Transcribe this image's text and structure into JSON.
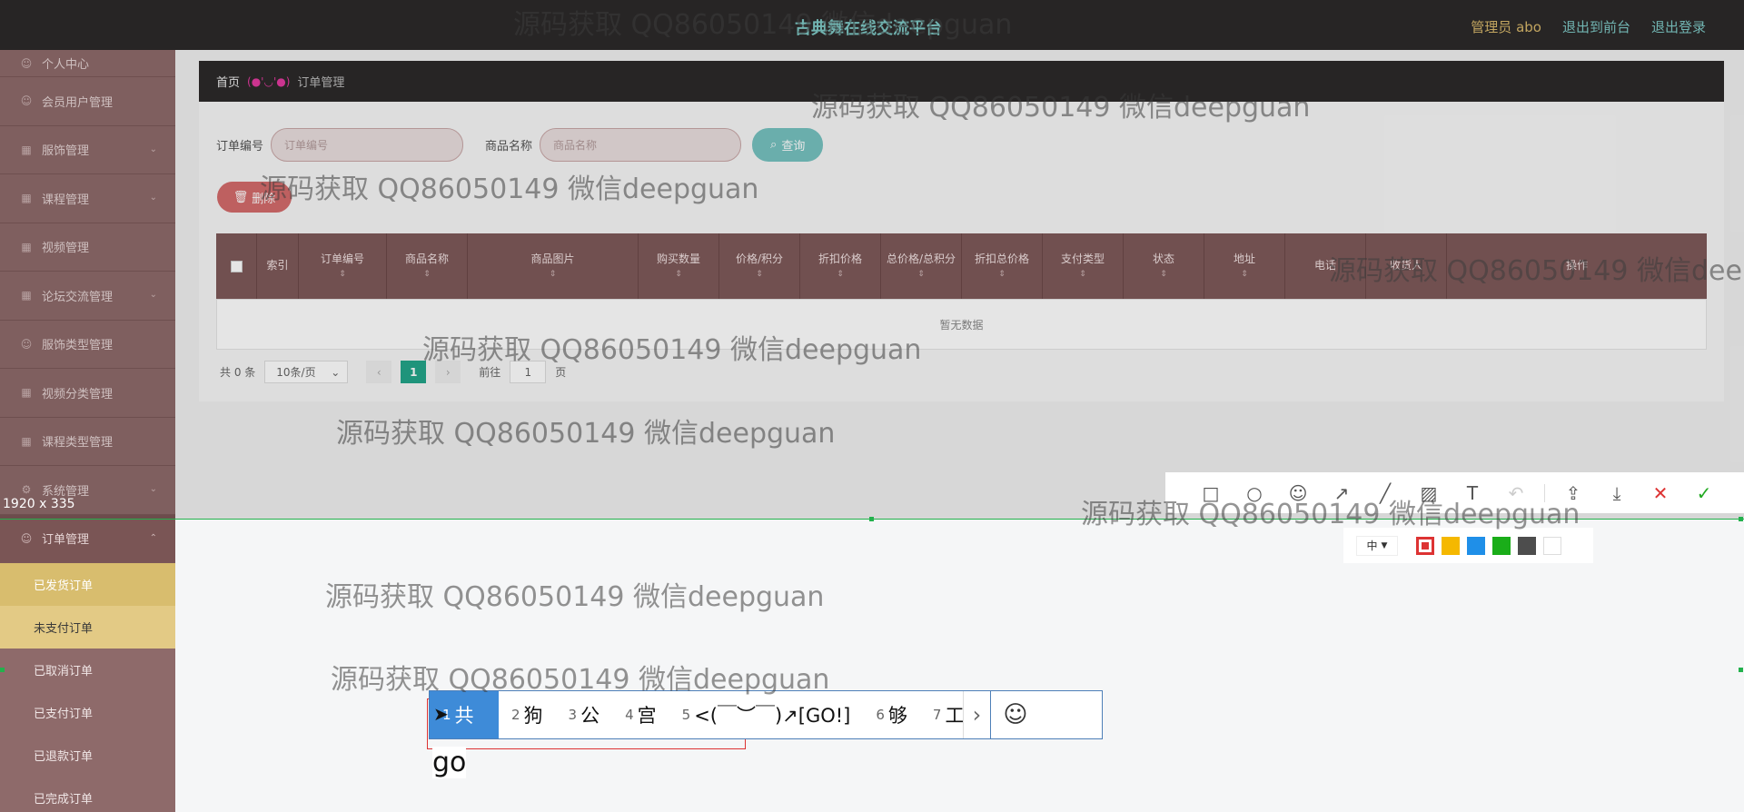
{
  "topbar": {
    "title": "古典舞在线交流平台",
    "admin_label": "管理员 abo",
    "link_front": "退出到前台",
    "link_logout": "退出登录"
  },
  "sidebar": {
    "items": [
      {
        "label": "个人中心"
      },
      {
        "label": "会员用户管理"
      },
      {
        "label": "服饰管理"
      },
      {
        "label": "课程管理"
      },
      {
        "label": "视频管理"
      },
      {
        "label": "论坛交流管理"
      },
      {
        "label": "服饰类型管理"
      },
      {
        "label": "视频分类管理"
      },
      {
        "label": "课程类型管理"
      },
      {
        "label": "系统管理"
      },
      {
        "label": "订单管理"
      }
    ],
    "sub_items": [
      {
        "label": "已发货订单"
      },
      {
        "label": "未支付订单"
      },
      {
        "label": "已取消订单"
      },
      {
        "label": "已支付订单"
      },
      {
        "label": "已退款订单"
      },
      {
        "label": "已完成订单"
      }
    ]
  },
  "breadcrumb": {
    "home": "首页",
    "face": "(●'◡'●)",
    "current": "订单管理"
  },
  "search": {
    "order_no_label": "订单编号",
    "order_no_placeholder": "订单编号",
    "product_label": "商品名称",
    "product_placeholder": "商品名称",
    "query_button": "查询"
  },
  "delete_button": "删除",
  "table": {
    "headers": [
      "索引",
      "订单编号",
      "商品名称",
      "商品图片",
      "购买数量",
      "价格/积分",
      "折扣价格",
      "总价格/总积分",
      "折扣总价格",
      "支付类型",
      "状态",
      "地址",
      "电话",
      "收货人",
      "操作"
    ],
    "empty_text": "暂无数据"
  },
  "pager": {
    "total": "共 0 条",
    "page_size": "10条/页",
    "current_page": "1",
    "goto_label": "前往",
    "goto_value": "1",
    "page_suffix": "页"
  },
  "capture": {
    "dimensions": "1920 x 335"
  },
  "screenshot_tools": {
    "size_label": "中",
    "colors": [
      "#e02020",
      "#f5b800",
      "#1f8fe8",
      "#1aad19",
      "#4d4d4d",
      "#ffffff"
    ]
  },
  "ime": {
    "candidates": [
      {
        "n": "1",
        "text": "共"
      },
      {
        "n": "2",
        "text": "狗"
      },
      {
        "n": "3",
        "text": "公"
      },
      {
        "n": "4",
        "text": "宫"
      },
      {
        "n": "5",
        "text": "<(￣︶￣)↗[GO!]"
      },
      {
        "n": "6",
        "text": "够"
      },
      {
        "n": "7",
        "text": "工"
      }
    ],
    "composition": "go"
  },
  "watermark": "源码获取 QQ86050149 微信deepguan"
}
